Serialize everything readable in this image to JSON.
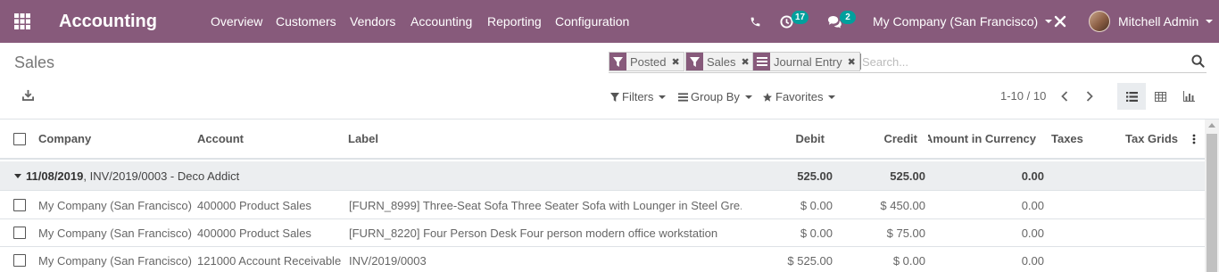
{
  "navbar": {
    "app_title": "Accounting",
    "menu": [
      "Overview",
      "Customers",
      "Vendors",
      "Accounting",
      "Reporting",
      "Configuration"
    ],
    "activity_count": "17",
    "message_count": "2",
    "company": "My Company (San Francisco)",
    "user": "Mitchell Admin",
    "brand_color": "#875a7b",
    "badge_color": "#00a09d"
  },
  "page": {
    "title": "Sales"
  },
  "search": {
    "facets": [
      {
        "label": "Posted",
        "icon": "filter-icon"
      },
      {
        "label": "Sales",
        "icon": "filter-icon"
      },
      {
        "label": "Journal Entry",
        "icon": "group-by-icon"
      }
    ],
    "placeholder": "Search..."
  },
  "controls": {
    "filters": "Filters",
    "group_by": "Group By",
    "favorites": "Favorites",
    "pager": "1-10 / 10"
  },
  "table": {
    "columns": {
      "company": "Company",
      "account": "Account",
      "label": "Label",
      "debit": "Debit",
      "credit": "Credit",
      "amount_currency": "Amount in Currency",
      "taxes": "Taxes",
      "tax_grids": "Tax Grids"
    },
    "group": {
      "date": "11/08/2019",
      "rest": ", INV/2019/0003 - Deco Addict",
      "debit": "525.00",
      "credit": "525.00",
      "amount_currency": "0.00"
    },
    "rows": [
      {
        "company": "My Company (San Francisco)",
        "account": "400000 Product Sales",
        "label": "[FURN_8999] Three-Seat Sofa Three Seater Sofa with Lounger in Steel Gre...",
        "debit": "$ 0.00",
        "credit": "$ 450.00",
        "amount_currency": "0.00"
      },
      {
        "company": "My Company (San Francisco)",
        "account": "400000 Product Sales",
        "label": "[FURN_8220] Four Person Desk Four person modern office workstation",
        "debit": "$ 0.00",
        "credit": "$ 75.00",
        "amount_currency": "0.00"
      },
      {
        "company": "My Company (San Francisco)",
        "account": "121000 Account Receivable",
        "label": "INV/2019/0003",
        "debit": "$ 525.00",
        "credit": "$ 0.00",
        "amount_currency": "0.00"
      }
    ]
  }
}
